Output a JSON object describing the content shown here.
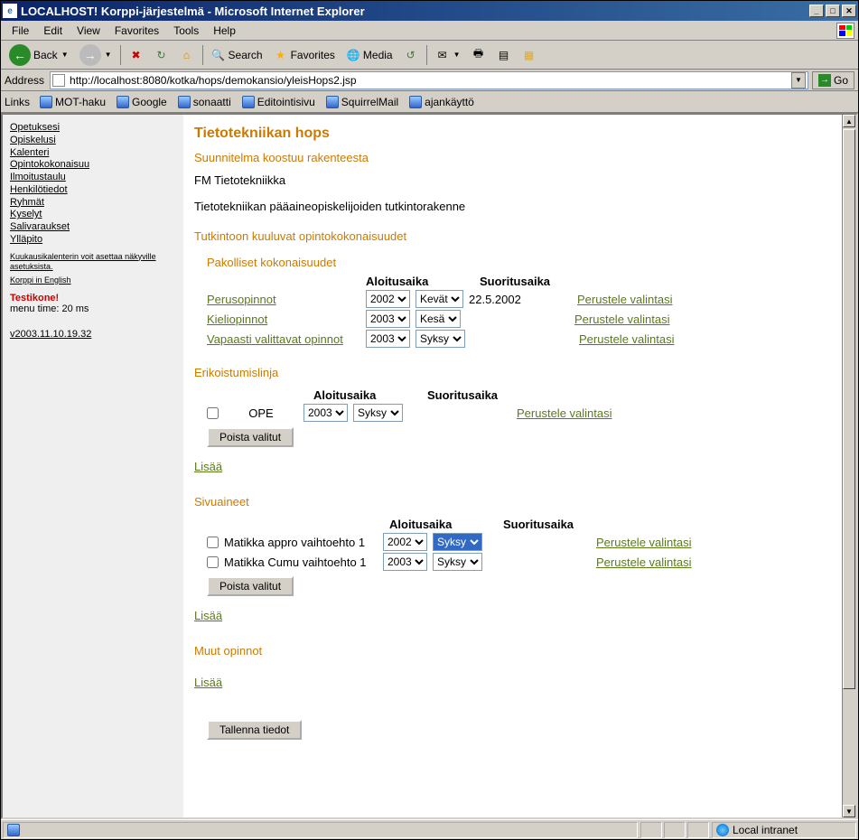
{
  "window": {
    "title": "LOCALHOST! Korppi-järjestelmä - Microsoft Internet Explorer"
  },
  "menubar": [
    "File",
    "Edit",
    "View",
    "Favorites",
    "Tools",
    "Help"
  ],
  "toolbar": {
    "back": "Back",
    "search": "Search",
    "favorites": "Favorites",
    "media": "Media"
  },
  "addressbar": {
    "label": "Address",
    "url": "http://localhost:8080/kotka/hops/demokansio/yleisHops2.jsp",
    "go": "Go"
  },
  "linksbar": {
    "label": "Links",
    "items": [
      "MOT-haku",
      "Google",
      "sonaatti",
      "Editointisivu",
      "SquirrelMail",
      "ajankäyttö"
    ]
  },
  "sidebar": {
    "items": [
      "Opetuksesi",
      "Opiskelusi",
      "Kalenteri",
      "Opintokokonaisuu",
      "Ilmoitustaulu",
      "Henkilötiedot",
      "Ryhmät",
      "Kyselyt",
      "Salivaraukset",
      "Ylläpito"
    ],
    "small1": "Kuukausikalenterin voit asettaa näkyville asetuksista.",
    "small2": "Korppi in English",
    "testikone": "Testikone!",
    "menutime": "menu time: 20 ms",
    "version": "v2003.11.10.19.32"
  },
  "main": {
    "title": "Tietotekniikan hops",
    "subtitle": "Suunnitelma koostuu rakenteesta",
    "program": "FM Tietotekniikka",
    "desc": "Tietotekniikan pääaineopiskelijoiden tutkintorakenne",
    "section_studies": "Tutkintoon kuuluvat opintokokonaisuudet",
    "mandatory": {
      "title": "Pakolliset kokonaisuudet",
      "col_start": "Aloitusaika",
      "col_done": "Suoritusaika",
      "rows": [
        {
          "name": "Perusopinnot",
          "year": "2002",
          "term": "Kevät",
          "done": "22.5.2002",
          "justify": "Perustele valintasi"
        },
        {
          "name": "Kieliopinnot",
          "year": "2003",
          "term": "Kesä",
          "done": "",
          "justify": "Perustele valintasi"
        },
        {
          "name": "Vapaasti valittavat opinnot",
          "year": "2003",
          "term": "Syksy",
          "done": "",
          "justify": "Perustele valintasi"
        }
      ]
    },
    "spec": {
      "title": "Erikoistumislinja",
      "col_start": "Aloitusaika",
      "col_done": "Suoritusaika",
      "rows": [
        {
          "name": "OPE",
          "year": "2003",
          "term": "Syksy",
          "justify": "Perustele valintasi"
        }
      ],
      "remove": "Poista valitut",
      "add": "Lisää"
    },
    "minors": {
      "title": "Sivuaineet",
      "col_start": "Aloitusaika",
      "col_done": "Suoritusaika",
      "rows": [
        {
          "name": "Matikka appro vaihtoehto 1",
          "year": "2002",
          "term": "Syksy",
          "highlight": true,
          "justify": "Perustele valintasi"
        },
        {
          "name": "Matikka Cumu vaihtoehto 1",
          "year": "2003",
          "term": "Syksy",
          "justify": "Perustele valintasi"
        }
      ],
      "remove": "Poista valitut",
      "add": "Lisää"
    },
    "other": {
      "title": "Muut opinnot",
      "add": "Lisää"
    },
    "save": "Tallenna tiedot"
  },
  "statusbar": {
    "zone": "Local intranet"
  }
}
